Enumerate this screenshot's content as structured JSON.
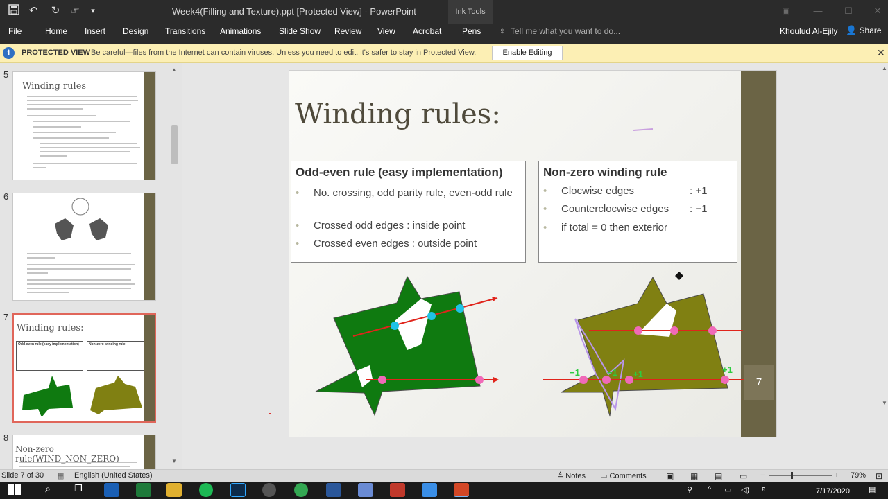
{
  "window": {
    "title": "Week4(Filling and Texture).ppt [Protected View] - PowerPoint",
    "contextual_tab": "Ink Tools",
    "quick_access_icons": [
      "save-icon",
      "undo-icon",
      "redo-icon",
      "touch-mode-icon",
      "customize-icon"
    ]
  },
  "ribbon": {
    "tabs": [
      "File",
      "Home",
      "Insert",
      "Design",
      "Transitions",
      "Animations",
      "Slide Show",
      "Review",
      "View",
      "Acrobat",
      "Pens"
    ],
    "tell_me": "Tell me what you want to do...",
    "user": "Khoulud Al-Ejily",
    "share": "Share"
  },
  "protected_view": {
    "label": "PROTECTED VIEW",
    "message": "Be careful—files from the Internet can contain viruses. Unless you need to edit, it's safer to stay in Protected View.",
    "button": "Enable Editing"
  },
  "thumbnails": [
    {
      "number": "5",
      "title": "Winding rules"
    },
    {
      "number": "6",
      "title": ""
    },
    {
      "number": "7",
      "title": "Winding rules:",
      "selected": true,
      "left_label": "Odd-even rule (easy implementation)",
      "right_label": "Non-zero winding rule"
    },
    {
      "number": "8",
      "title": "Non-zero rule(WIND_NON_ZERO)"
    }
  ],
  "slide": {
    "title": "Winding rules:",
    "left_box": {
      "heading": "Odd-even rule (easy implementation)",
      "bullets": [
        "No. crossing, odd parity rule, even-odd rule",
        "Crossed odd  edges  : inside point",
        "Crossed even edges : outside point"
      ]
    },
    "right_box": {
      "heading": "Non-zero winding rule",
      "bullets": [
        {
          "text": "Clocwise edges",
          "value": ": +1"
        },
        {
          "text": "Counterclocwise edges",
          "value": ": −1"
        },
        {
          "text": "if total = 0 then exterior",
          "value": ""
        }
      ]
    },
    "annotations": [
      "−1",
      "−1",
      "+1",
      "+1"
    ],
    "slide_number": "7",
    "colors": {
      "green_fill": "#0f7a10",
      "olive_fill": "#808012",
      "ray": "#e0241b",
      "cyan_point": "#1fc3e6",
      "pink_point": "#f06ab8"
    }
  },
  "status_bar": {
    "slide_info": "Slide 7 of 30",
    "language": "English (United States)",
    "notes": "Notes",
    "comments": "Comments",
    "zoom": "79%"
  },
  "taskbar": {
    "date": "7/17/2020"
  }
}
